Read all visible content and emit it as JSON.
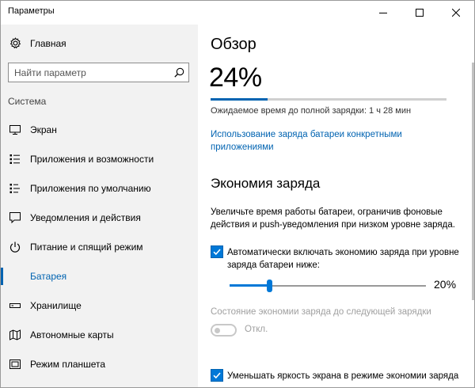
{
  "window": {
    "title": "Параметры"
  },
  "sidebar": {
    "home_label": "Главная",
    "search_placeholder": "Найти параметр",
    "section_label": "Система",
    "items": [
      {
        "label": "Экран",
        "icon": "monitor-icon"
      },
      {
        "label": "Приложения и возможности",
        "icon": "apps-list-icon"
      },
      {
        "label": "Приложения по умолчанию",
        "icon": "default-apps-icon"
      },
      {
        "label": "Уведомления и действия",
        "icon": "notifications-icon"
      },
      {
        "label": "Питание и спящий режим",
        "icon": "power-icon"
      },
      {
        "label": "Батарея",
        "icon": "battery-icon",
        "active": true
      },
      {
        "label": "Хранилище",
        "icon": "storage-icon"
      },
      {
        "label": "Автономные карты",
        "icon": "offline-maps-icon"
      },
      {
        "label": "Режим планшета",
        "icon": "tablet-mode-icon"
      }
    ]
  },
  "overview": {
    "heading": "Обзор",
    "percent_text": "24%",
    "charge_fraction": 0.24,
    "estimate": "Ожидаемое время до полной зарядки: 1 ч 28 мин",
    "usage_link": "Использование заряда батареи конкретными приложениями"
  },
  "saver": {
    "heading": "Экономия заряда",
    "description": "Увеличьте время работы батареи, ограничив фоновые действия и push-уведомления при низком уровне заряда.",
    "auto_checkbox_label": "Автоматически включать экономию заряда при уровне заряда батареи ниже:",
    "auto_checked": true,
    "threshold_fraction": 0.2,
    "threshold_text": "20%",
    "status_label": "Состояние экономии заряда до следующей зарядки",
    "toggle_label": "Откл.",
    "toggle_on": false,
    "brightness_checkbox_label": "Уменьшать яркость экрана в режиме экономии заряда",
    "brightness_checked": true
  },
  "colors": {
    "accent": "#0078d7",
    "link": "#0063b1",
    "sidebar_bg": "#f2f2f2",
    "disabled": "#a0a0a0"
  }
}
